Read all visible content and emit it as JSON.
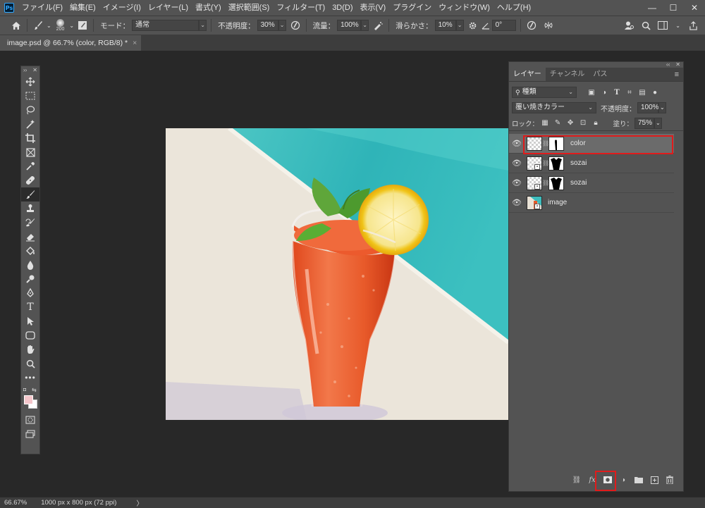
{
  "menu": {
    "logo": "Ps",
    "items": [
      "ファイル(F)",
      "編集(E)",
      "イメージ(I)",
      "レイヤー(L)",
      "書式(Y)",
      "選択範囲(S)",
      "フィルター(T)",
      "3D(D)",
      "表示(V)",
      "プラグイン",
      "ウィンドウ(W)",
      "ヘルプ(H)"
    ]
  },
  "window_controls": {
    "minimize": "—",
    "maximize": "☐",
    "close": "✕"
  },
  "options": {
    "brush_size": "200",
    "mode_label": "モード：",
    "mode_value": "通常",
    "opacity_label": "不透明度：",
    "opacity_value": "30%",
    "flow_label": "流量：",
    "flow_value": "100%",
    "smoothing_label": "滑らかさ：",
    "smoothing_value": "10%",
    "angle_value": "0°"
  },
  "document_tab": {
    "title": "image.psd @ 66.7% (color, RGB/8) *",
    "close": "×"
  },
  "toolbar": {
    "tools": [
      "move-tool",
      "marquee-tool",
      "lasso-tool",
      "magic-wand-tool",
      "crop-tool",
      "frame-tool",
      "eyedropper-tool",
      "healing-tool",
      "brush-tool",
      "stamp-tool",
      "history-brush-tool",
      "eraser-tool",
      "paint-bucket-tool",
      "blur-tool",
      "dodge-tool",
      "pen-tool",
      "type-tool",
      "path-select-tool",
      "shape-tool",
      "hand-tool",
      "zoom-tool",
      "more-tools"
    ],
    "active_tool": "brush-tool",
    "foreground_color": "#f5c6cb",
    "background_color": "#ffffff"
  },
  "layers_panel": {
    "tabs": [
      "レイヤー",
      "チャンネル",
      "パス"
    ],
    "active_tab": "レイヤー",
    "filter_kind": "種類",
    "blend_mode": "覆い焼きカラー",
    "opacity_label": "不透明度：",
    "opacity_value": "100%",
    "lock_label": "ロック：",
    "fill_label": "塗り：",
    "fill_value": "75%",
    "layers": [
      {
        "name": "color",
        "selected": true,
        "has_mask": true
      },
      {
        "name": "sozai",
        "selected": false,
        "has_mask": true
      },
      {
        "name": "sozai",
        "selected": false,
        "has_mask": true
      },
      {
        "name": "image",
        "selected": false,
        "has_mask": false
      }
    ],
    "footer_icons": [
      "link-icon",
      "fx-icon",
      "add-mask-icon",
      "adjustment-icon",
      "folder-icon",
      "new-layer-icon",
      "trash-icon"
    ],
    "highlight_color": "#e01b1b"
  },
  "status": {
    "zoom": "66.67%",
    "doc_info": "1000 px x 800 px (72 ppi)",
    "arrow": "〉"
  }
}
